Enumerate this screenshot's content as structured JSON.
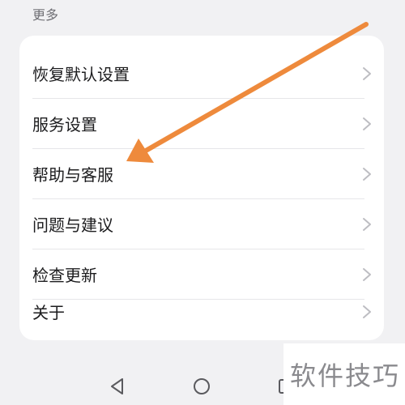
{
  "section": {
    "title": "更多"
  },
  "menu": {
    "items": [
      {
        "label": "恢复默认设置"
      },
      {
        "label": "服务设置"
      },
      {
        "label": "帮助与客服"
      },
      {
        "label": "问题与建议"
      },
      {
        "label": "检查更新"
      },
      {
        "label": "关于"
      }
    ]
  },
  "annotation": {
    "color": "#ee8a3c"
  },
  "navbar": {
    "icons": [
      "back-icon",
      "home-icon",
      "recents-icon"
    ]
  },
  "watermark": {
    "text": "软件技巧"
  }
}
